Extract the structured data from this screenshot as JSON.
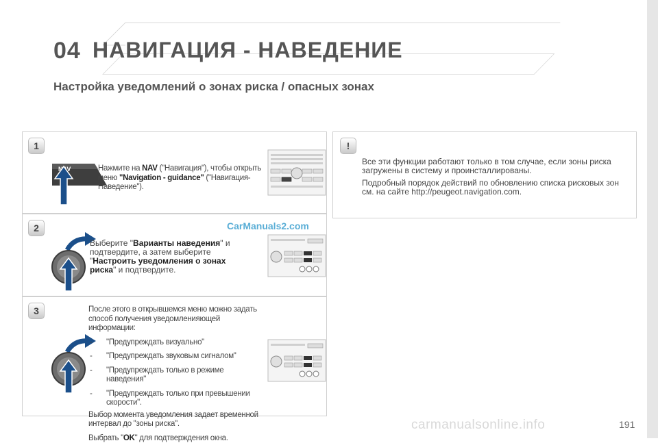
{
  "header": {
    "chapter_number": "04",
    "chapter_title": "НАВИГАЦИЯ - НАВЕДЕНИЕ",
    "subtitle": "Настройка уведомлений о зонах риска / опасных зонах"
  },
  "steps": [
    {
      "badge": "1",
      "button_label": "NAV",
      "text_parts": [
        "Нажмите на ",
        "NAV",
        " (\"Навигация\"), чтобы открыть меню ",
        "\"Navigation - guidance\"",
        " (\"Навигация-Наведение\")."
      ]
    },
    {
      "badge": "2",
      "text_parts": [
        "Выберите \"",
        "Варианты наведения",
        "\" и подтвердите, а затем выберите \"",
        "Настроить уведомления о зонах риска",
        "\" и подтвердите."
      ]
    },
    {
      "badge": "3",
      "intro": "После этого в открывшемся меню можно задать способ получения уведомленияющей информации:",
      "options": [
        "\"Предупреждать визуально\"",
        "\"Предупреждать звуковым сигналом\"",
        "\"Предупреждать только в режиме наведения\"",
        "\"Предупреждать только при превышении скорости\"."
      ],
      "note": "Выбор момента уведомления задает временной интервал до \"зоны риска\".",
      "confirm_parts": [
        "Выбрать \"",
        "OK",
        "\" для подтверждения окна."
      ]
    }
  ],
  "info_box": {
    "badge": "!",
    "paragraphs": [
      "Все эти функции работают только в том случае, если зоны риска загружены в систему и проинсталлированы.",
      "Подробный порядок действий по обновлению списка рисковых зон см. на сайте http://peugeot.navigation.com."
    ]
  },
  "watermark": "CarManuals2.com",
  "footer_watermark": "carmanualsonline.info",
  "page_number": "191",
  "colors": {
    "heading": "#555555",
    "watermark": "#5aaed6",
    "arrow": "#1b4f8a"
  }
}
